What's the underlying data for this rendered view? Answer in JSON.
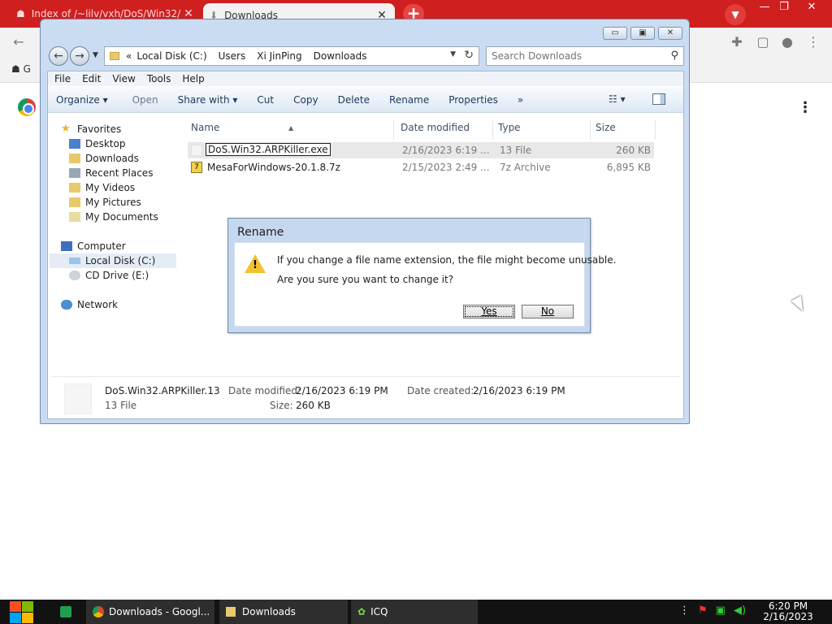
{
  "browser": {
    "tabs": [
      {
        "title": "Index of /~lilv/vxh/DoS/Win32/",
        "icon": "page-icon"
      },
      {
        "title": "Downloads",
        "icon": "download-icon"
      }
    ],
    "new_tab": "+",
    "bookmark_prefix": "G",
    "window_controls": {
      "minimize": "—",
      "restore": "❐",
      "close": "✕"
    },
    "accent_color": "#cf1f1f"
  },
  "explorer": {
    "address": {
      "prefix": "«",
      "crumbs": [
        "Local Disk (C:)",
        "Users",
        "Xi JinPing",
        "Downloads"
      ]
    },
    "search_placeholder": "Search Downloads",
    "menu": [
      "File",
      "Edit",
      "View",
      "Tools",
      "Help"
    ],
    "commands": {
      "organize": "Organize",
      "open": "Open",
      "share_with": "Share with",
      "cut": "Cut",
      "copy": "Copy",
      "delete": "Delete",
      "rename": "Rename",
      "properties": "Properties",
      "more": "»"
    },
    "nav": {
      "favorites": "Favorites",
      "desktop": "Desktop",
      "downloads": "Downloads",
      "recent_places": "Recent Places",
      "my_videos": "My Videos",
      "my_pictures": "My Pictures",
      "my_documents": "My Documents",
      "computer": "Computer",
      "local_disk": "Local Disk (C:)",
      "cd_drive": "CD Drive (E:)",
      "network": "Network"
    },
    "columns": {
      "name": "Name",
      "date_modified": "Date modified",
      "type": "Type",
      "size": "Size"
    },
    "files": [
      {
        "name": "DoS.Win32.ARPKiller.exe",
        "date": "2/16/2023 6:19 ...",
        "type": "13 File",
        "size": "260 KB"
      },
      {
        "name": "MesaForWindows-20.1.8.7z",
        "date": "2/15/2023 2:49 ...",
        "type": "7z Archive",
        "size": "6,895 KB"
      }
    ],
    "details": {
      "name": "DoS.Win32.ARPKiller.13",
      "type": "13 File",
      "date_modified_label": "Date modified:",
      "date_modified": "2/16/2023 6:19 PM",
      "date_created_label": "Date created:",
      "date_created": "2/16/2023 6:19 PM",
      "size_label": "Size:",
      "size": "260 KB"
    }
  },
  "dialog": {
    "title": "Rename",
    "line1": "If you change a file name extension, the file might become unusable.",
    "line2": "Are you sure you want to change it?",
    "yes": "Yes",
    "no": "No",
    "icon": "warning-icon"
  },
  "taskbar": {
    "apps": [
      {
        "label": "Downloads - Googl...",
        "icon": "chrome-icon"
      },
      {
        "label": "Downloads",
        "icon": "folder-icon"
      },
      {
        "label": "ICQ",
        "icon": "icq-icon"
      }
    ],
    "time": "6:20 PM",
    "date": "2/16/2023"
  }
}
